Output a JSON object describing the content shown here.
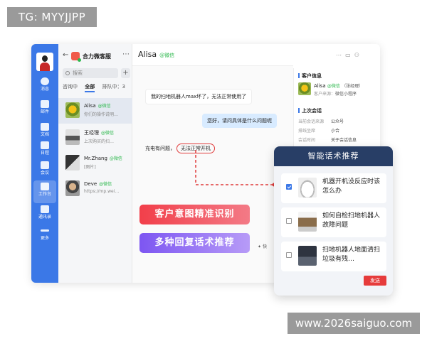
{
  "watermarks": {
    "top": "TG: MYYJJPP",
    "bottom": "www.2026saiguo.com"
  },
  "rail": {
    "items": [
      {
        "label": "消息",
        "icon": "message-icon"
      },
      {
        "label": "邮件",
        "icon": "mail-icon"
      },
      {
        "label": "文档",
        "icon": "document-icon"
      },
      {
        "label": "日程",
        "icon": "calendar-icon"
      },
      {
        "label": "会议",
        "icon": "meeting-icon"
      },
      {
        "label": "工作台",
        "icon": "workbench-icon"
      },
      {
        "label": "通讯录",
        "icon": "contacts-icon"
      },
      {
        "label": "更多",
        "icon": "more-icon"
      }
    ]
  },
  "list": {
    "app_name": "合力微客服",
    "search_placeholder": "搜索",
    "tabs": [
      "咨询中",
      "全部",
      "排队中：3"
    ],
    "active_tab": "全部",
    "conversations": [
      {
        "name": "Alisa",
        "tag": "@微信",
        "preview": "你们的操作说明…"
      },
      {
        "name": "王经理",
        "tag": "@微信",
        "preview": "上次购买的扫…"
      },
      {
        "name": "Mr.Zhang",
        "tag": "@微信",
        "preview": "[图片]"
      },
      {
        "name": "Deve",
        "tag": "@微信",
        "preview": "https://mp.wei…"
      }
    ]
  },
  "chat": {
    "contact": "Alisa",
    "contact_tag": "@微信",
    "messages": {
      "m1": "我的扫地机器人max坏了，无法正常使用了",
      "m2": "您好，请问具体是什么问题呢",
      "m3_prefix": "充电有问题，",
      "m3_highlight": "无法正常开机"
    },
    "feature_1": "客户意图精准识别",
    "feature_2": "多种回复话术推荐",
    "footer_hint": "快"
  },
  "panel": {
    "customer_title": "客户信息",
    "customer_name": "Alisa",
    "customer_tag": "@微信",
    "customer_manager": "（张经理）",
    "source_label": "客户来源：",
    "source_value": "微信小程序",
    "last_session_title": "上次会话",
    "rows": [
      {
        "k": "当前会话来源",
        "v": "公众号"
      },
      {
        "k": "排线坐席",
        "v": "小合"
      },
      {
        "k": "会话时间",
        "v": "关于会话信息"
      }
    ]
  },
  "reco": {
    "title": "智能话术推荐",
    "items": [
      {
        "text": "机器开机没反应时该怎么办",
        "checked": true
      },
      {
        "text": "如何自检扫地机器人故障问题",
        "checked": false
      },
      {
        "text": "扫地机器人地面清扫垃圾有残…",
        "checked": false
      }
    ],
    "send_label": "发送"
  }
}
